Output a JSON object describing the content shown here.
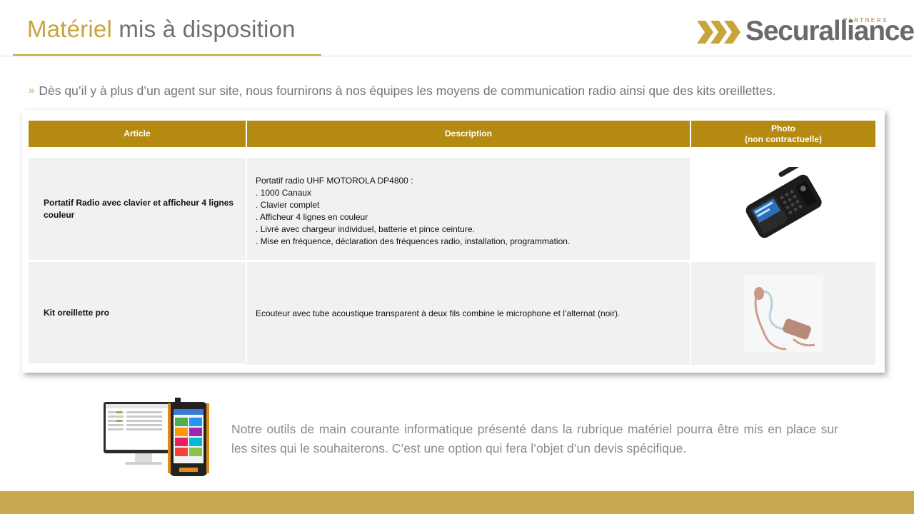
{
  "header": {
    "title_highlight": "Matériel",
    "title_rest": " mis à disposition",
    "logo_word": "Securalliance",
    "logo_tagline": "PARTNERS"
  },
  "intro": {
    "text": "Dès qu’il y à plus d’un agent sur site, nous fournirons à nos équipes les moyens de communication radio ainsi que des kits oreillettes."
  },
  "table": {
    "headers": {
      "article": "Article",
      "description": "Description",
      "photo_line1": "Photo",
      "photo_line2": "(non contractuelle)"
    },
    "rows": [
      {
        "article": "Portatif Radio avec clavier et afficheur 4 lignes couleur",
        "description": [
          "Portatif radio UHF MOTOROLA DP4800 :",
          ". 1000 Canaux",
          ". Clavier complet",
          ". Afficheur 4 lignes en couleur",
          ". Livré avec chargeur individuel, batterie et pince ceinture.",
          ". Mise en fréquence, déclaration des fréquences radio, installation, programmation."
        ],
        "photo_icon": "radio-photo"
      },
      {
        "article": "Kit oreillette pro",
        "description": [
          "Ecouteur avec tube acoustique transparent à deux fils combine le microphone et l’alternat (noir)."
        ],
        "photo_icon": "earpiece-photo"
      }
    ]
  },
  "bottom": {
    "text": "Notre outils de main courante informatique présenté dans la rubrique matériel pourra être mis en place sur les sites qui le souhaiterons. C’est une option qui fera l’objet d’un devis spécifique.",
    "image_icon": "computer-and-tablet-image"
  },
  "colors": {
    "gold": "#c8a43c",
    "table_header": "#b48a10",
    "footer": "#c8a94f"
  }
}
